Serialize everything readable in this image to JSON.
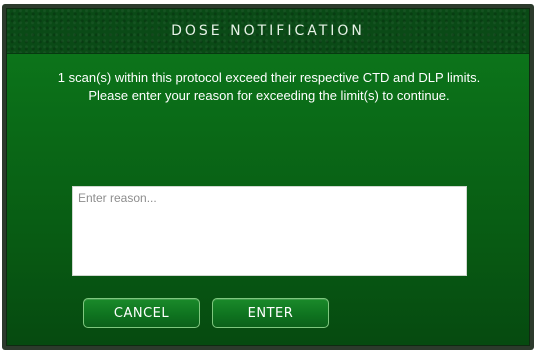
{
  "dialog": {
    "title": "DOSE NOTIFICATION",
    "message": "1 scan(s) within this protocol exceed their respective CTD and DLP limits. Please enter your reason for exceeding the limit(s) to continue.",
    "reason_input": {
      "placeholder": "Enter reason...",
      "value": ""
    },
    "buttons": {
      "cancel_label": "CANCEL",
      "enter_label": "ENTER"
    }
  },
  "colors": {
    "dialog_background": "#0a6a17",
    "title_bar": "#0a4a16",
    "button_border": "#7fc77f",
    "text": "#ffffff"
  }
}
